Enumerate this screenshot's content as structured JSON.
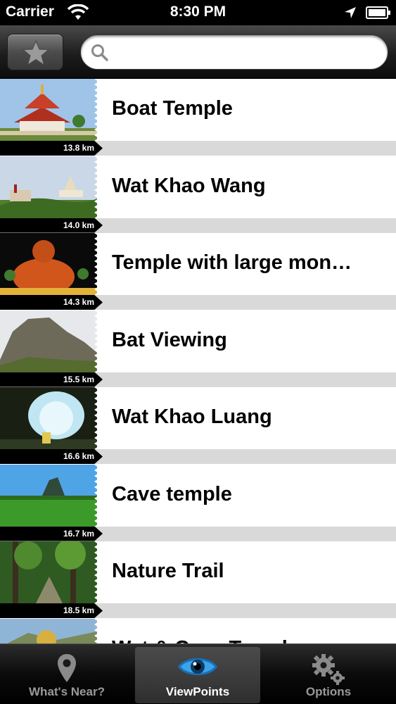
{
  "status_bar": {
    "carrier": "Carrier",
    "time": "8:30 PM"
  },
  "search": {
    "placeholder": "",
    "value": ""
  },
  "toolbar": {
    "favorites_icon": "star-icon"
  },
  "list": {
    "items": [
      {
        "title": "Boat Temple",
        "distance": "13.8 km"
      },
      {
        "title": "Wat Khao Wang",
        "distance": "14.0 km"
      },
      {
        "title": "Temple with large mon…",
        "distance": "14.3 km"
      },
      {
        "title": "Bat Viewing",
        "distance": "15.5 km"
      },
      {
        "title": "Wat Khao Luang",
        "distance": "16.6 km"
      },
      {
        "title": "Cave temple",
        "distance": "16.7 km"
      },
      {
        "title": "Nature Trail",
        "distance": "18.5 km"
      },
      {
        "title": "Wat & Cave Temple",
        "distance": ""
      }
    ]
  },
  "tab_bar": {
    "tabs": [
      {
        "label": "What's Near?",
        "icon": "map-pin-icon",
        "active": false
      },
      {
        "label": "ViewPoints",
        "icon": "eye-icon",
        "active": true
      },
      {
        "label": "Options",
        "icon": "gears-icon",
        "active": false
      }
    ]
  },
  "colors": {
    "accent": "#2a8fd6",
    "distance_strip": "#d9d9d9"
  }
}
